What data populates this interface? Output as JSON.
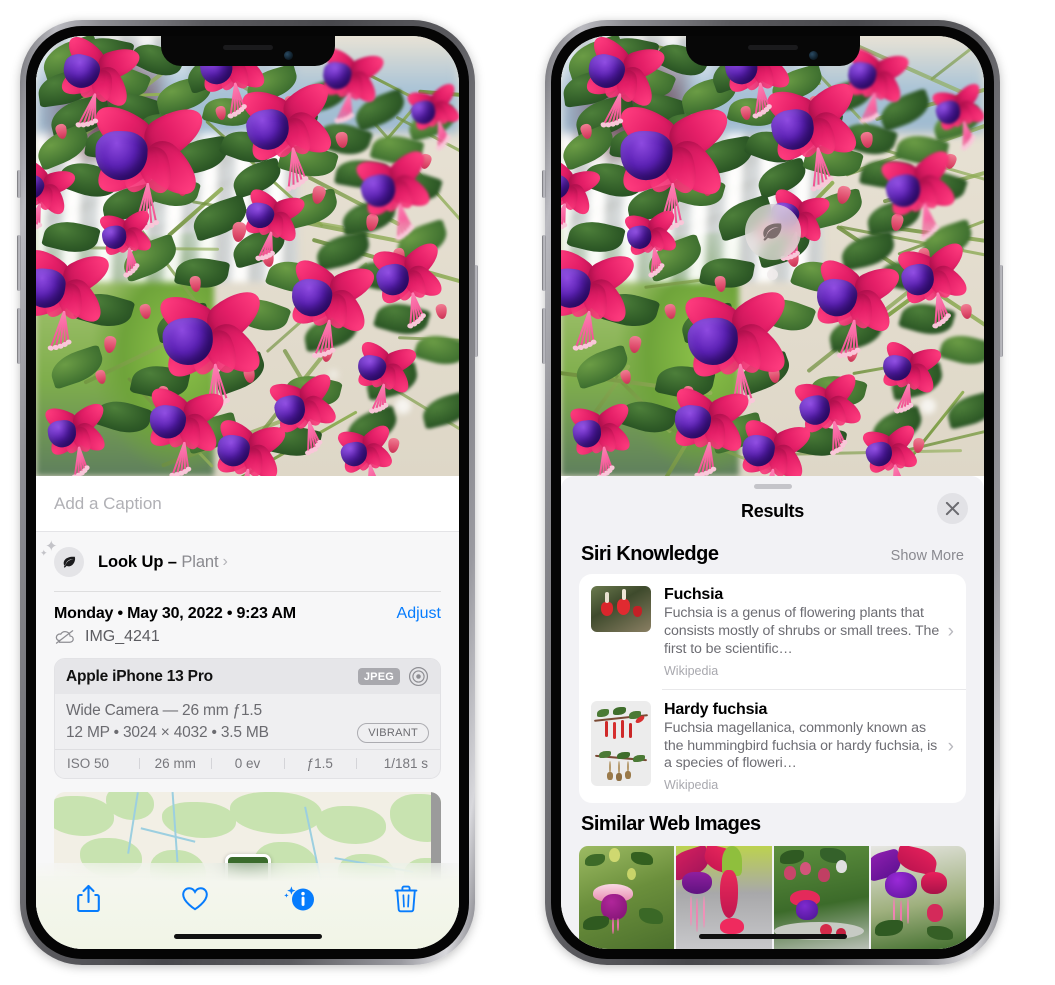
{
  "left_phone": {
    "name": "photos-app-info-screen",
    "caption": {
      "placeholder": "Add a Caption",
      "value": ""
    },
    "lookup": {
      "icon": "leaf-icon",
      "label": "Look Up",
      "separator": "–",
      "subject": "Plant",
      "chevron": "›"
    },
    "date_row": {
      "date_text": "Monday • May 30, 2022 • 9:23 AM",
      "adjust_label": "Adjust"
    },
    "file_row": {
      "icon": "icloud-slash-icon",
      "filename": "IMG_4241"
    },
    "exif": {
      "device": "Apple iPhone 13 Pro",
      "format_badge": "JPEG",
      "aperture_icon": "aperture-icon",
      "lens_line": "Wide Camera — 26 mm ƒ1.5",
      "specs_line": "12 MP • 3024 × 4032 • 3.5 MB",
      "style_badge": "VIBRANT",
      "stats": [
        "ISO 50",
        "26 mm",
        "0 ev",
        "ƒ1.5",
        "1/181 s"
      ]
    },
    "toolbar": [
      {
        "name": "share-button",
        "icon": "share-icon"
      },
      {
        "name": "favorite-button",
        "icon": "heart-icon"
      },
      {
        "name": "info-button",
        "icon": "info-sparkle-icon"
      },
      {
        "name": "delete-button",
        "icon": "trash-icon"
      }
    ]
  },
  "right_phone": {
    "name": "visual-lookup-results-screen",
    "lookup_badge": {
      "icon": "leaf-icon"
    },
    "sheet": {
      "title": "Results",
      "close_icon": "close-icon",
      "sections": [
        {
          "title": "Siri Knowledge",
          "action_label": "Show More",
          "items": [
            {
              "title": "Fuchsia",
              "description": "Fuchsia is a genus of flowering plants that consists mostly of shrubs or small trees. The first to be scientific…",
              "source": "Wikipedia",
              "thumbnail": "red-fuchsia-flowers-photo",
              "chevron": "›"
            },
            {
              "title": "Hardy fuchsia",
              "description": "Fuchsia magellanica, commonly known as the hummingbird fuchsia or hardy fuchsia, is a species of floweri…",
              "source": "Wikipedia",
              "thumbnail": "hardy-fuchsia-specimen-photo",
              "chevron": "›"
            }
          ]
        },
        {
          "title": "Similar Web Images",
          "images": [
            "fuchsia-pink-white-bloom",
            "fuchsia-red-closeup",
            "fuchsia-bush-buds",
            "fuchsia-purple-hanging"
          ]
        }
      ]
    }
  },
  "colors": {
    "accent_blue": "#067cfd",
    "sheet_bg": "#f2f2f5",
    "info_bg": "#f7f7f8",
    "card_bg": "#ffffff",
    "secondary_text": "#6d6d73"
  }
}
